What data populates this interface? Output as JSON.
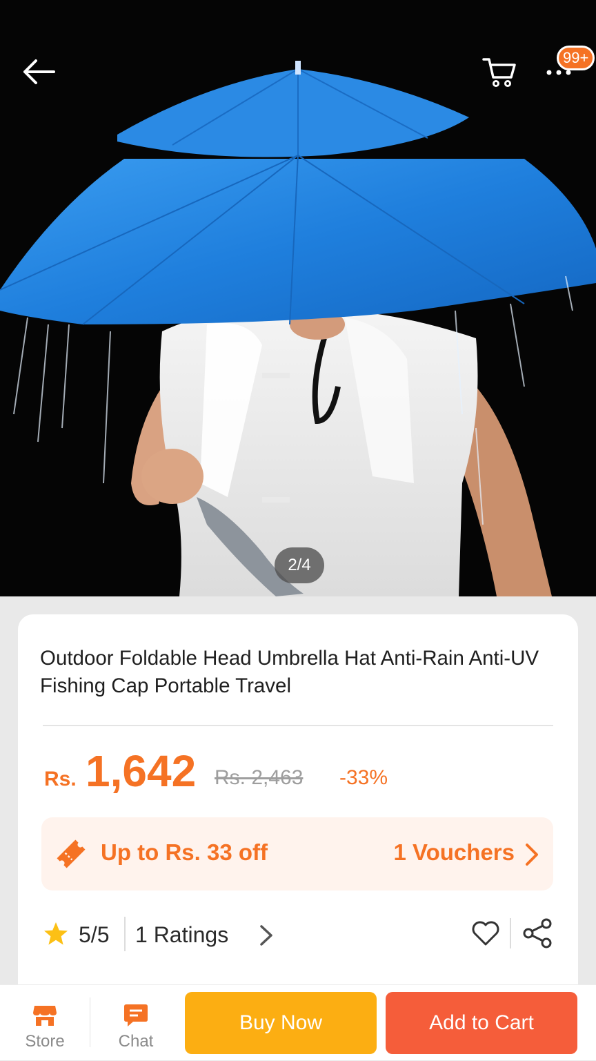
{
  "header": {
    "back_icon": "arrow-left-icon",
    "cart_icon": "cart-icon",
    "more_icon": "more-dots-icon",
    "badge": "99+"
  },
  "gallery": {
    "pager": "2/4"
  },
  "product": {
    "title": "Outdoor Foldable Head Umbrella Hat Anti-Rain Anti-UV Fishing Cap Portable Travel",
    "currency": "Rs.",
    "price": "1,642",
    "original_price": "Rs. 2,463",
    "discount": "-33%"
  },
  "voucher": {
    "text": "Up to Rs. 33 off",
    "count": "1 Vouchers"
  },
  "rating": {
    "score": "5/5",
    "count": "1 Ratings"
  },
  "bottom_bar": {
    "store_label": "Store",
    "chat_label": "Chat",
    "buy_now_label": "Buy Now",
    "add_to_cart_label": "Add to Cart"
  },
  "colors": {
    "accent": "#f57224",
    "buy_now": "#fcae12",
    "add_to_cart": "#f55d3a",
    "umbrella": "#1f7fdd"
  }
}
